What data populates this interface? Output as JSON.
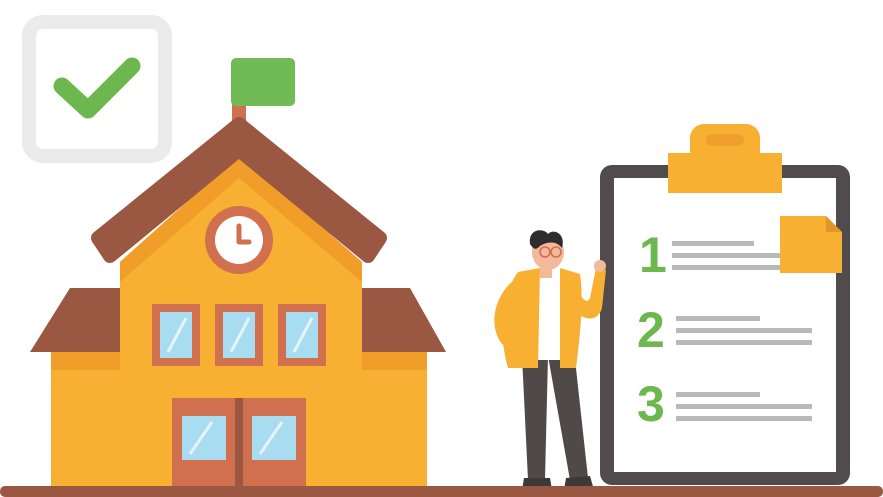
{
  "colors": {
    "background": "#ffffff",
    "check_box_border": "#ebebeb",
    "check_mark": "#6cb84f",
    "flag": "#71bb55",
    "roof": "#9a5742",
    "wall": "#f7b032",
    "wall_shade": "#f19d29",
    "trim": "#d0704e",
    "window_glass": "#a8dcf0",
    "clipboard_frame": "#514b4d",
    "clipboard_clip": "#f7b032",
    "list_number": "#6cb84f",
    "list_lines": "#b9b9b9",
    "sticky_note": "#f7b032",
    "ground": "#9a5742"
  },
  "icons": {
    "check": "check-icon",
    "clock": "clock-icon",
    "flag": "flag-icon"
  },
  "checklist": {
    "items": [
      {
        "number": "1"
      },
      {
        "number": "2"
      },
      {
        "number": "3"
      }
    ]
  }
}
